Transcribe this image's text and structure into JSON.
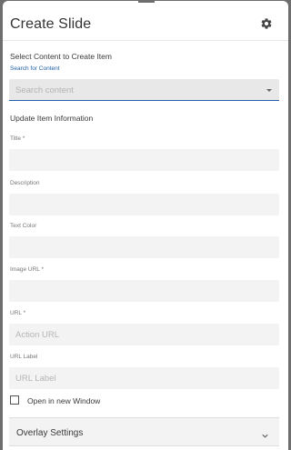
{
  "header": {
    "title": "Create Slide",
    "settings_icon": "gear-icon"
  },
  "content_select": {
    "section_label": "Select Content to Create Item",
    "link_label": "Search for Content",
    "placeholder": "Search content"
  },
  "item_info": {
    "section_label": "Update Item Information",
    "fields": {
      "title": {
        "label": "Title *",
        "value": ""
      },
      "description": {
        "label": "Description",
        "value": ""
      },
      "text_color": {
        "label": "Text Color",
        "value": ""
      },
      "image_url": {
        "label": "Image URL *",
        "value": ""
      },
      "url": {
        "label": "URL *",
        "placeholder": "Action URL"
      },
      "url_label": {
        "label": "URL Label",
        "placeholder": "URL Label"
      }
    },
    "open_new_window": {
      "label": "Open in new Window",
      "checked": false
    }
  },
  "overlay": {
    "label": "Overlay Settings",
    "icon": "chevron-down-icon"
  },
  "colors": {
    "accent": "#1f5fa8",
    "field_bg": "#f3f3f3",
    "select_bg": "#e8e8e8"
  }
}
